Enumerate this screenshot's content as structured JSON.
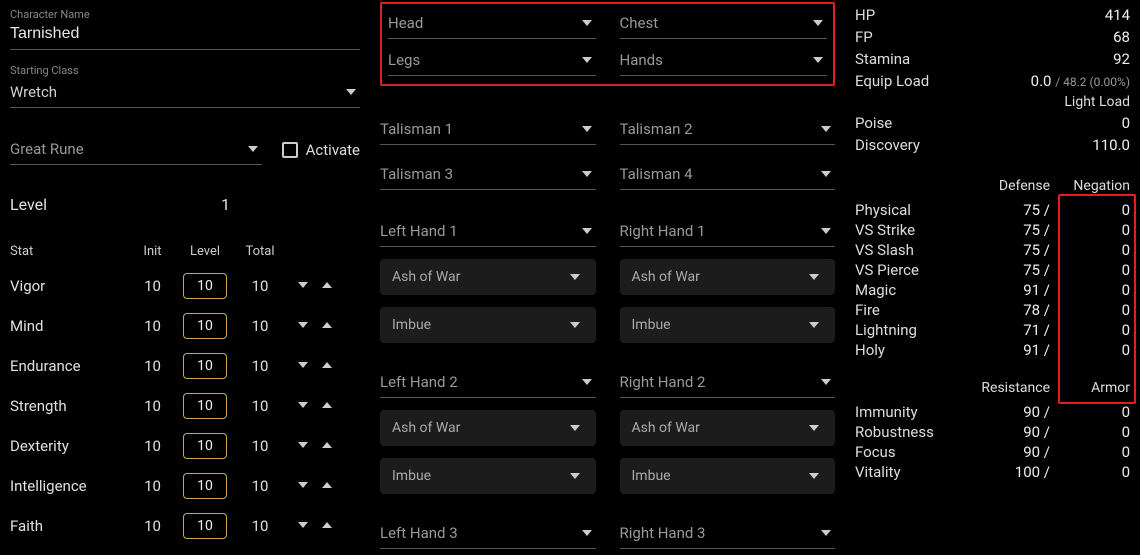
{
  "character": {
    "name_label": "Character Name",
    "name_value": "Tarnished",
    "class_label": "Starting Class",
    "class_value": "Wretch",
    "great_rune_label": "Great Rune",
    "activate_label": "Activate",
    "level_label": "Level",
    "level_value": "1"
  },
  "stat_headers": {
    "stat": "Stat",
    "init": "Init",
    "level": "Level",
    "total": "Total"
  },
  "stats": [
    {
      "name": "Vigor",
      "init": "10",
      "level": "10",
      "total": "10"
    },
    {
      "name": "Mind",
      "init": "10",
      "level": "10",
      "total": "10"
    },
    {
      "name": "Endurance",
      "init": "10",
      "level": "10",
      "total": "10"
    },
    {
      "name": "Strength",
      "init": "10",
      "level": "10",
      "total": "10"
    },
    {
      "name": "Dexterity",
      "init": "10",
      "level": "10",
      "total": "10"
    },
    {
      "name": "Intelligence",
      "init": "10",
      "level": "10",
      "total": "10"
    },
    {
      "name": "Faith",
      "init": "10",
      "level": "10",
      "total": "10"
    }
  ],
  "armor": {
    "head": "Head",
    "chest": "Chest",
    "legs": "Legs",
    "hands": "Hands"
  },
  "talismans": {
    "t1": "Talisman 1",
    "t2": "Talisman 2",
    "t3": "Talisman 3",
    "t4": "Talisman 4"
  },
  "weapons": {
    "lh1": "Left Hand 1",
    "rh1": "Right Hand 1",
    "lh2": "Left Hand 2",
    "rh2": "Right Hand 2",
    "lh3": "Left Hand 3",
    "rh3": "Right Hand 3",
    "ash": "Ash of War",
    "imbue": "Imbue"
  },
  "derived": {
    "hp_label": "HP",
    "hp_value": "414",
    "fp_label": "FP",
    "fp_value": "68",
    "stamina_label": "Stamina",
    "stamina_value": "92",
    "equip_load_label": "Equip Load",
    "equip_load_value": "0.0",
    "equip_load_sub": "/ 48.2 (0.00%)",
    "load_status": "Light Load",
    "poise_label": "Poise",
    "poise_value": "0",
    "discovery_label": "Discovery",
    "discovery_value": "110.0"
  },
  "defense_headers": {
    "defense": "Defense",
    "negation": "Negation"
  },
  "defense": [
    {
      "name": "Physical",
      "def": "75 /",
      "neg": "0"
    },
    {
      "name": "VS Strike",
      "def": "75 /",
      "neg": "0"
    },
    {
      "name": "VS Slash",
      "def": "75 /",
      "neg": "0"
    },
    {
      "name": "VS Pierce",
      "def": "75 /",
      "neg": "0"
    },
    {
      "name": "Magic",
      "def": "91 /",
      "neg": "0"
    },
    {
      "name": "Fire",
      "def": "78 /",
      "neg": "0"
    },
    {
      "name": "Lightning",
      "def": "71 /",
      "neg": "0"
    },
    {
      "name": "Holy",
      "def": "91 /",
      "neg": "0"
    }
  ],
  "resist_headers": {
    "resistance": "Resistance",
    "armor": "Armor"
  },
  "resist": [
    {
      "name": "Immunity",
      "res": "90 /",
      "arm": "0"
    },
    {
      "name": "Robustness",
      "res": "90 /",
      "arm": "0"
    },
    {
      "name": "Focus",
      "res": "90 /",
      "arm": "0"
    },
    {
      "name": "Vitality",
      "res": "100 /",
      "arm": "0"
    }
  ]
}
